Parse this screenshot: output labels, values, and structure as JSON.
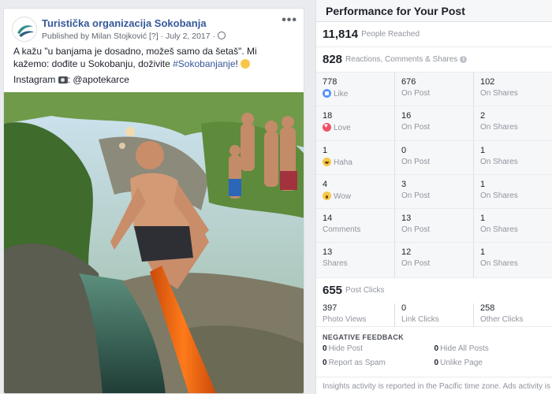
{
  "post": {
    "page_name": "Turistička organizacija Sokobanja",
    "meta": "Published by Milan Stojković [?] · July 2, 2017 ·",
    "more": "•••",
    "text_line1": "A kažu \"u banjama je dosadno, možeš samo da šetaš\". Mi kažemo: dođite u Sokobanju, doživite ",
    "hashtag": "#Sokobanjanje",
    "text_line1_end": "!",
    "instagram_prefix": "Instagram",
    "instagram_handle": ": @apotekarce"
  },
  "panel": {
    "title": "Performance for Your Post",
    "reached_value": "11,814",
    "reached_label": "People Reached",
    "engagement_value": "828",
    "engagement_label": "Reactions, Comments & Shares",
    "reactions": [
      {
        "icon": "like-icon",
        "cls": "like",
        "total": "778",
        "label": "Like",
        "on_post": "676",
        "on_shares": "102"
      },
      {
        "icon": "love-icon",
        "cls": "love",
        "total": "18",
        "label": "Love",
        "on_post": "16",
        "on_shares": "2"
      },
      {
        "icon": "haha-icon",
        "cls": "haha",
        "total": "1",
        "label": "Haha",
        "on_post": "0",
        "on_shares": "1"
      },
      {
        "icon": "wow-icon",
        "cls": "wow",
        "total": "4",
        "label": "Wow",
        "on_post": "3",
        "on_shares": "1"
      },
      {
        "icon": "",
        "cls": "",
        "total": "14",
        "label": "Comments",
        "on_post": "13",
        "on_shares": "1"
      },
      {
        "icon": "",
        "cls": "",
        "total": "13",
        "label": "Shares",
        "on_post": "12",
        "on_shares": "1"
      }
    ],
    "on_post_label": "On Post",
    "on_shares_label": "On Shares",
    "post_clicks_value": "655",
    "post_clicks_label": "Post Clicks",
    "clicks": [
      {
        "value": "397",
        "label": "Photo Views"
      },
      {
        "value": "0",
        "label": "Link Clicks"
      },
      {
        "value": "258",
        "label": "Other Clicks"
      }
    ],
    "negative_title": "NEGATIVE FEEDBACK",
    "negative": [
      {
        "value": "0",
        "label": "Hide Post"
      },
      {
        "value": "0",
        "label": "Hide All Posts"
      },
      {
        "value": "0",
        "label": "Report as Spam"
      },
      {
        "value": "0",
        "label": "Unlike Page"
      }
    ],
    "footnote": "Insights activity is reported in the Pacific time zone. Ads activity is"
  }
}
